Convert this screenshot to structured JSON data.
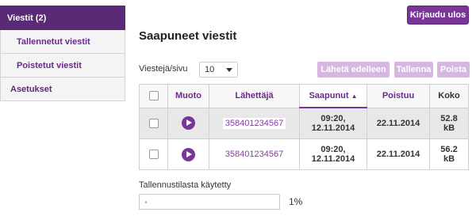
{
  "sidebar": {
    "items": [
      {
        "label": "Viestit (2)"
      },
      {
        "label": "Tallennetut viestit"
      },
      {
        "label": "Poistetut viestit"
      },
      {
        "label": "Asetukset"
      }
    ]
  },
  "header": {
    "logout_label": "Kirjaudu ulos",
    "title": "Saapuneet viestit"
  },
  "toolbar": {
    "per_page_label": "Viestejä/sivu",
    "per_page_value": "10",
    "forward_label": "Lähetä edelleen",
    "save_label": "Tallenna",
    "delete_label": "Poista"
  },
  "table": {
    "columns": [
      "Muoto",
      "Lähettäjä",
      "Saapunut",
      "Poistuu",
      "Koko"
    ],
    "sort_indicator": "▲",
    "rows": [
      {
        "sender": "358401234567",
        "received_time": "09:20,",
        "received_date": "12.11.2014",
        "expires": "22.11.2014",
        "size_num": "52.8",
        "size_unit": "kB"
      },
      {
        "sender": "358401234567",
        "received_time": "09:20,",
        "received_date": "12.11.2014",
        "expires": "22.11.2014",
        "size_num": "56.2",
        "size_unit": "kB"
      }
    ]
  },
  "storage": {
    "label": "Tallennustilasta käytetty",
    "percent_text": "1%",
    "used_fraction": 0.01
  },
  "colors": {
    "accent": "#7a3598",
    "sidebar_active": "#5b2a76",
    "disabled_button": "#d6b7e1"
  }
}
